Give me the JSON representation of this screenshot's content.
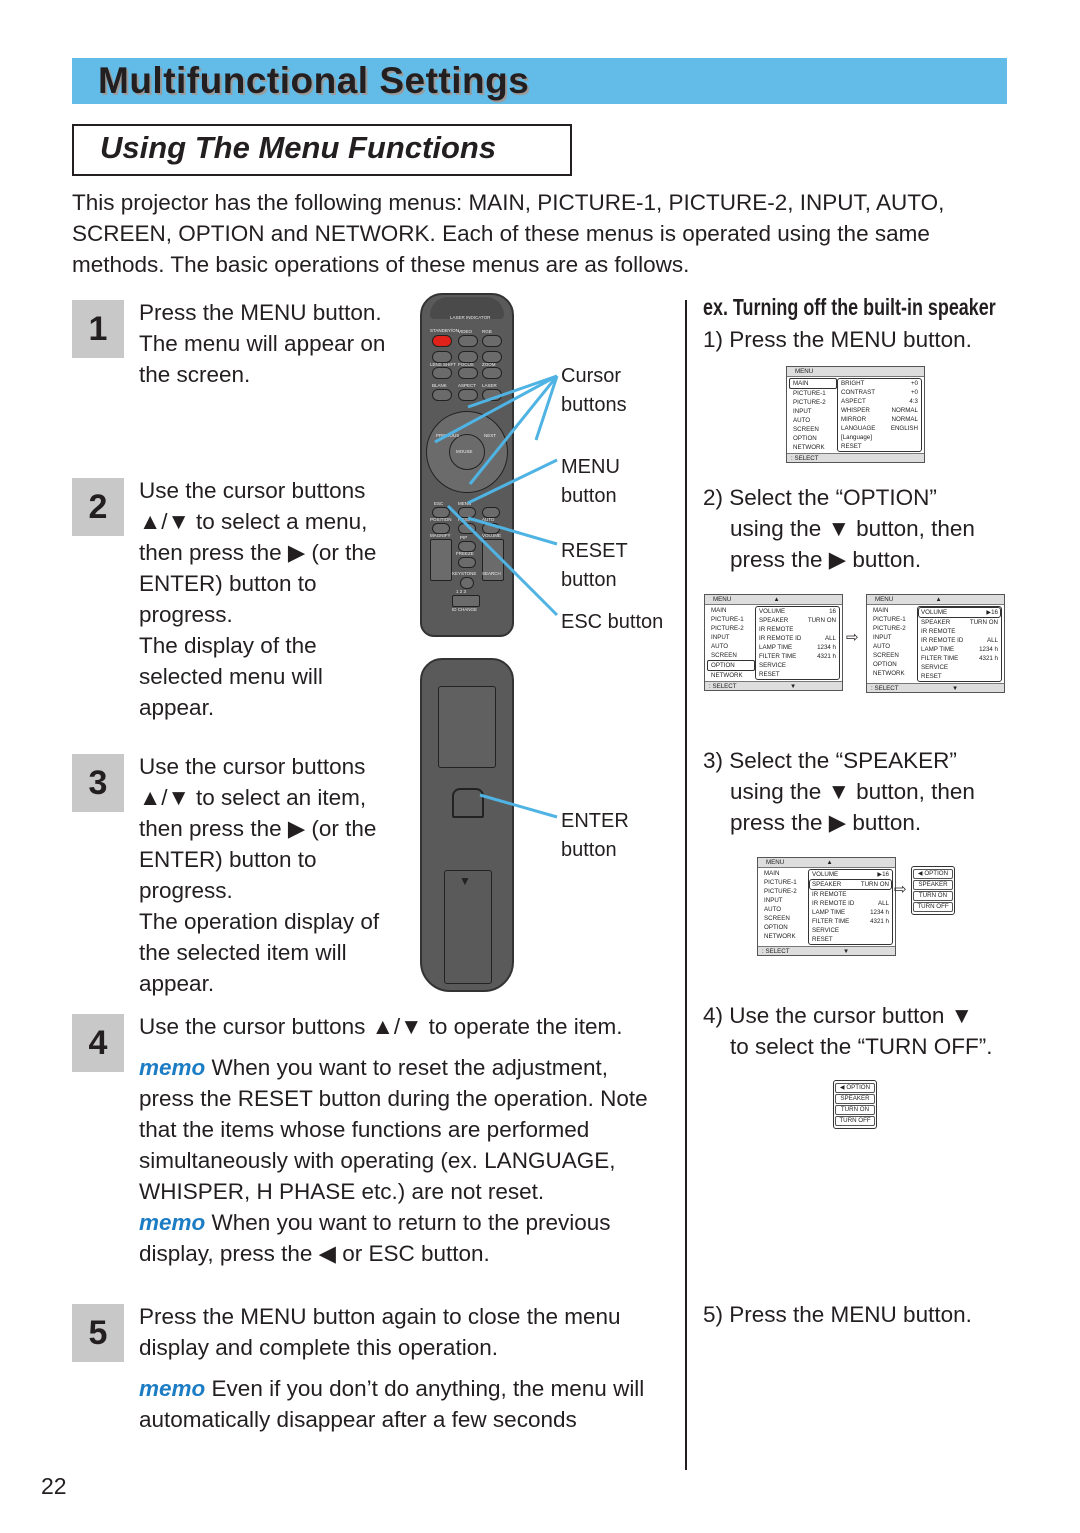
{
  "header": {
    "title": "Multifunctional Settings",
    "subtitle": "Using The Menu Functions"
  },
  "intro": [
    "This projector has the following menus: MAIN, PICTURE-1, PICTURE-2, INPUT, AUTO,",
    "SCREEN, OPTION and NETWORK. Each of these menus is operated using the same",
    "methods. The basic operations of these menus are as follows."
  ],
  "steps": [
    {
      "num": "1",
      "lines": [
        "Press the MENU button.",
        "The menu will appear on",
        "the screen."
      ]
    },
    {
      "num": "2",
      "lines": [
        "Use the cursor buttons",
        "▲/▼ to select a menu,",
        "then press the ▶ (or the",
        "ENTER) button to",
        "progress.",
        "The display of the",
        "selected menu will",
        "appear."
      ]
    },
    {
      "num": "3",
      "lines": [
        "Use the cursor buttons",
        "▲/▼ to select an item,",
        "then press the ▶ (or the",
        "ENTER) button to",
        "progress.",
        "The operation display of",
        "the selected item will",
        "appear."
      ]
    },
    {
      "num": "4",
      "lines": [
        "Use the cursor buttons ▲/▼ to operate the item."
      ]
    },
    {
      "num": "5",
      "lines": [
        "Press the MENU button again to close the menu",
        "display and complete this operation."
      ]
    }
  ],
  "memo_label": "memo",
  "memos": [
    [
      "When you want to reset the adjustment,",
      "press the RESET button during the operation. Note",
      "that the items whose functions are performed",
      "simultaneously with operating (ex. LANGUAGE,",
      "WHISPER, H PHASE etc.) are not reset."
    ],
    [
      "When you want to return to the previous",
      "display, press the ◀ or ESC button."
    ],
    [
      "Even if you don’t do anything, the menu will",
      "automatically disappear after a few seconds"
    ]
  ],
  "remote_labels": {
    "cursor": [
      "Cursor",
      "buttons"
    ],
    "menu": [
      "MENU",
      "button"
    ],
    "reset": [
      "RESET",
      "button"
    ],
    "esc": "ESC button",
    "enter": [
      "ENTER",
      "button"
    ]
  },
  "remote_buttons": {
    "laser_indicator": "LASER INDICATOR",
    "standby": "STANDBY/ON",
    "video": "VIDEO",
    "rgb": "RGB",
    "lens": "LENS SHIFT",
    "focus": "FOCUS",
    "zoom": "ZOOM",
    "blank": "BLANK",
    "aspect": "ASPECT",
    "laser": "LASER",
    "previous": "PREVIOUS",
    "next": "NEXT",
    "mouse": "MOUSE",
    "esc": "ESC",
    "menu": "MENU",
    "position": "POSITION",
    "reset": "RESET",
    "auto": "AUTO",
    "magnify": "MAGNIFY",
    "on": "ON",
    "off": "OFF",
    "pip": "PIP",
    "volume": "VOLUME",
    "freeze": "FREEZE",
    "mute": "MUTE",
    "keystone": "KEYSTONE",
    "search": "SEARCH",
    "id": "ID CHANGE",
    "ids": "1 2 3"
  },
  "example": {
    "title": "ex. Turning off the built-in speaker",
    "steps": [
      [
        "1) Press the MENU button."
      ],
      [
        "2) Select the “OPTION”",
        "using the ▼ button, then",
        "press the ▶ button."
      ],
      [
        "3) Select the “SPEAKER”",
        "using the ▼ button, then",
        "press the ▶ button."
      ],
      [
        "4) Use the cursor button ▼",
        "to select the “TURN OFF”."
      ],
      [
        "5) Press the MENU button."
      ]
    ]
  },
  "menus": {
    "header": "MENU",
    "footer": ": SELECT",
    "left": [
      "MAIN",
      "PICTURE-1",
      "PICTURE-2",
      "INPUT",
      "AUTO",
      "SCREEN",
      "OPTION",
      "NETWORK"
    ],
    "main_rows": [
      [
        "BRIGHT",
        "+0"
      ],
      [
        "CONTRAST",
        "+0"
      ],
      [
        "ASPECT",
        "4:3"
      ],
      [
        "WHISPER",
        "NORMAL"
      ],
      [
        "MIRROR",
        "NORMAL"
      ],
      [
        "LANGUAGE",
        "ENGLISH"
      ],
      [
        "[Language]",
        ""
      ],
      [
        "RESET",
        ""
      ]
    ],
    "option_rows": [
      [
        "VOLUME",
        "16"
      ],
      [
        "SPEAKER",
        "TURN ON"
      ],
      [
        "IR REMOTE",
        ""
      ],
      [
        "IR REMOTE ID",
        "ALL"
      ],
      [
        "LAMP TIME",
        "1234 h"
      ],
      [
        "FILTER TIME",
        "4321 h"
      ],
      [
        "SERVICE",
        ""
      ],
      [
        "RESET",
        ""
      ]
    ],
    "option_rows_sel": [
      [
        "VOLUME",
        "▶16"
      ],
      [
        "SPEAKER",
        "TURN ON"
      ],
      [
        "IR REMOTE",
        ""
      ],
      [
        "IR REMOTE ID",
        "ALL"
      ],
      [
        "LAMP TIME",
        "1234 h"
      ],
      [
        "FILTER TIME",
        "4321 h"
      ],
      [
        "SERVICE",
        ""
      ],
      [
        "RESET",
        ""
      ]
    ],
    "popup": [
      "◀ OPTION",
      "SPEAKER",
      "TURN ON",
      "TURN OFF"
    ]
  },
  "page_number": "22",
  "colors": {
    "title_bar": "#63bce8",
    "memo": "#1c7cc4",
    "pointer_lines": "#4fb3e3",
    "step_box": "#c8c8c8"
  }
}
